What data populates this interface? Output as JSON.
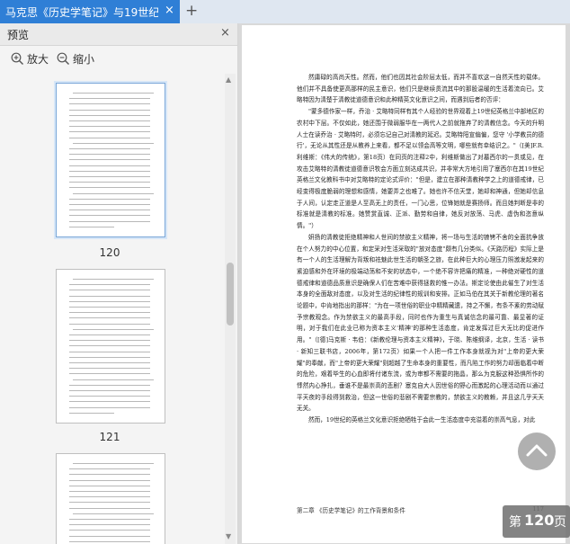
{
  "tab": {
    "title": "马克思《历史学笔记》与19世纪",
    "close": "×",
    "new_tab": "+"
  },
  "sidebar": {
    "title": "预览",
    "close": "×",
    "zoom_in": "放大",
    "zoom_out": "缩小",
    "thumbnails": [
      {
        "page": "120"
      },
      {
        "page": "121"
      }
    ]
  },
  "page_text": {
    "paragraphs": [
      "然庸碌的高尚天性。然而，他们也因其社会阶层太低，而并不喜欢这一自然天性的载体。他们并不具备使更高那样的民主意识，他们只是继续贯流其中的那股温暖的生活着流向已。艾略特因为清楚于清教徒道德意识和此种精英文化意识之间，而遇到后者的否评：",
      "\"蒙多德作家一样，乔治 · 艾略特同样有其个人经验的世界观着上19世纪英格兰中部地区的农村中下层。不仅如此，她还围于微弱服华在一两代人之前就拖弃了的清教信念。今天的升明人士在读乔治 · 艾略特时，必须忘记自己对清教的延迟。艾略特阳宣偏偏，您守 '小学教员的德行'，无论从其性还是从教养上来看，都不足以领会高等文明，哪些就有幸结识之。\"（[美]F.R.利维斯：《伟大的传统》，第18页）在同页的注释2中，利维斯做出了对墓西尔的一贯或见，在攻击艾略特的清教徒道德意识牧会方面立刻达成共识，并非常大方地引用了塞西尔在其19世纪英格兰文化教科书中对艾略特的定论式评价：\"但是，建立在那种清教种学之上的道德戒律，已经变得极度脆弱的理想和感情，她要弄之也难了。她也许不信天堂，她却和神通，但她却信息于人间，认定走正道是人至高无上的责任，一门心思，位锋她就是赛扬师。而且她判断是非的标准就是清教的标准。她赞赏直诚、正派、勤劳和自律，她反对放荡、马虎、虚伪和恣意纵情。\"）",
      "妍扬的清教徒拒绝精神和人世间的禁欲主义精神，将一场与生活的镣铐不舍的全面抗争放在个人努力的中心位置，和定采对生活采取的\"放对态度\"颇有几分类似。《天路历程》实际上是有一个人的生活理解为背叛和祛魅此世生活的朝圣之旅，在此种巨大的心理压力照激发起来的紧迫感和外在环境的极端动荡和不安的状态中，一个绝不容许把痛的精准，一种绝对硬性的道德戒律和道德品质意识是确保人们在苦难中获得拯救的惟一办法。斯定论使由此催生了对生活本身的全面敌对态度，以及对生活的纪律性的规训和安排。正如马伯在其关于新教伦理的著名论题中，中肯地指出的那样：\"为在一项世俗的职业中精精藏遗，持之不懈，有条不紊的劳动赋予宗教观念。作为禁欲主义的最高手段，同时也作为重生与真诚信念的最可靠、最显著的证明，对于我们在此业已称为资本主义'精神'的那种生活态度，肯定发挥过巨大无比的促进作用。\"（[德]马克斯 · 韦伯：《新教伦理与资本主义精神》，于晓、陈维纲译，北京，生活 · 读书 · 新知三联书店，2006年，第172页）如果一个人把一件工作本身就视为对\"上帝的更大荣耀\"的奉献，而\"上帝的更大荣耀\"则超越了生命本身的重要性，而凡陷工作的努力却面临着中断的危险，艰着毕生的心血即将付诸东流，或为审都不需要的拖晶，那么为克服这种恐惧所作的悸然内心挣扎，垂谁不是最崇高的悲剧？塞克自大人因世俗的野心而激起的心理活动而以通过平天夜的手段得到救治，但这一世俗的悲剧不需要宗教的，禁欲主义的教赖，并且这几乎天天无关。",
      "然而，19世纪的英格兰文化意识拒绝牺牲于会此一生活态度中充溢着的崇高气息，对此"
    ]
  },
  "footer": {
    "chapter": "第二章  《历史学笔记》的工作背景和条件",
    "page_no": "117"
  },
  "badge": {
    "prefix": "第",
    "page": "120",
    "suffix": "页"
  }
}
